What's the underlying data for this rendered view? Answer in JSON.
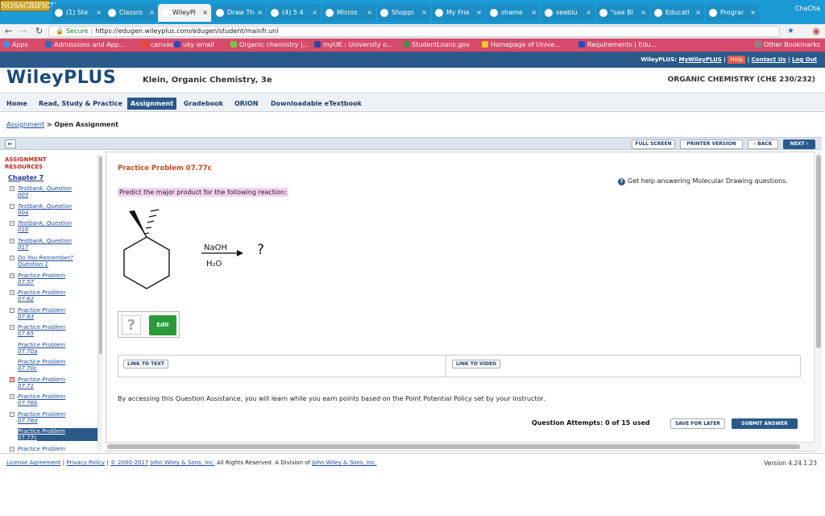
{
  "browser": {
    "profile_badge": "NOSACRIFICE",
    "user_name": "ChaCha",
    "tabs": [
      {
        "label": "(1) Ste"
      },
      {
        "label": "Classro"
      },
      {
        "label": "WileyPl"
      },
      {
        "label": "Draw Th"
      },
      {
        "label": "(4) 5 4"
      },
      {
        "label": "Micros"
      },
      {
        "label": "Shoppi"
      },
      {
        "label": "My Frie"
      },
      {
        "label": "shame"
      },
      {
        "label": "seeblu"
      },
      {
        "label": "\"see Bl"
      },
      {
        "label": "Educati"
      },
      {
        "label": "Prograr"
      }
    ],
    "secure_label": "Secure",
    "url": "https://edugen.wileyplus.com/edugen/student/mainfr.uni",
    "bookmarks": [
      {
        "label": "Apps",
        "color": "#4a90d9"
      },
      {
        "label": "Admissions and App...",
        "color": "#2a6ac4"
      },
      {
        "label": "canvas",
        "color": "#e84a2a"
      },
      {
        "label": "uky email",
        "color": "#2a4ab4"
      },
      {
        "label": "Organic chemistry |...",
        "color": "#7ac44a"
      },
      {
        "label": "myUK : University o...",
        "color": "#2a4a9a"
      },
      {
        "label": "StudentLoans.gov",
        "color": "#4a8a4a"
      },
      {
        "label": "Homepage of Unive...",
        "color": "#f4c42a"
      },
      {
        "label": "Requirements | Edu...",
        "color": "#2a4ab4"
      }
    ],
    "other_bookmarks": "Other Bookmarks"
  },
  "toplinks": {
    "wileyplus": "WileyPLUS:",
    "mywileyplus": "MyWileyPLUS",
    "help": "Help",
    "contact": "Contact Us",
    "logout": "Log Out",
    "sep": "|"
  },
  "header": {
    "logo": "WileyPLUS",
    "course": "Klein, Organic Chemistry, 3e",
    "course_code": "ORGANIC CHEMISTRY (CHE 230/232)"
  },
  "menu": [
    "Home",
    "Read, Study & Practice",
    "Assignment",
    "Gradebook",
    "ORION",
    "Downloadable eTextbook"
  ],
  "breadcrumb": {
    "link": "Assignment",
    "sep": ">",
    "current": "Open Assignment"
  },
  "toolbar": {
    "full_screen": "FULL SCREEN",
    "printer": "PRINTER VERSION",
    "back": "‹ BACK",
    "next": "NEXT ›"
  },
  "sidebar": {
    "title_line1": "ASSIGNMENT",
    "title_line2": "RESOURCES",
    "chapter": "Chapter 7",
    "items": [
      {
        "l1": "Testbank, Question",
        "l2": "003",
        "mark": "−"
      },
      {
        "l1": "Testbank, Question",
        "l2": "004",
        "mark": "−"
      },
      {
        "l1": "Testbank, Question",
        "l2": "010",
        "mark": "−"
      },
      {
        "l1": "Testbank, Question",
        "l2": "017",
        "mark": "−"
      },
      {
        "l1": "Do You Remember?",
        "l2": "Question 1",
        "mark": "−"
      },
      {
        "l1": "Practice Problem",
        "l2": "07.57",
        "mark": "−"
      },
      {
        "l1": "Practice Problem",
        "l2": "07.62",
        "mark": "−"
      },
      {
        "l1": "Practice Problem",
        "l2": "07.63",
        "mark": "−"
      },
      {
        "l1": "Practice Problem",
        "l2": "07.65",
        "mark": "−"
      },
      {
        "l1": "Practice Problem",
        "l2": "07.70a",
        "mark": ""
      },
      {
        "l1": "Practice Problem",
        "l2": "07.70c",
        "mark": ""
      },
      {
        "l1": "Practice Problem",
        "l2": "07.71",
        "mark": "x"
      },
      {
        "l1": "Practice Problem",
        "l2": "07.76b",
        "mark": "−"
      },
      {
        "l1": "Practice Problem",
        "l2": "07.76d",
        "mark": "−"
      },
      {
        "l1": "Practice Problem",
        "l2": "07.77c",
        "mark": ""
      },
      {
        "l1": "Practice Problem",
        "l2": "",
        "mark": "−"
      }
    ]
  },
  "problem": {
    "title": "Practice Problem 07.77c",
    "help_text": "Get help answering Molecular Drawing questions.",
    "prompt": "Predict the major product for the following reaction:",
    "reagent_top": "NaOH",
    "reagent_bottom": "H₂O",
    "product": "?",
    "edit_label": "Edit",
    "placeholder_glyph": "?",
    "link_text": "LINK TO TEXT",
    "link_video": "LINK TO VIDEO",
    "policy": "By accessing this Question Assistance, you will learn while you earn points based on the Point Potential Policy set by your instructor.",
    "attempts": "Question Attempts: 0 of 15 used",
    "save_later": "SAVE FOR LATER",
    "submit": "SUBMIT ANSWER"
  },
  "footer": {
    "license": "License Agreement",
    "privacy": "Privacy Policy",
    "copyright": "© 2000-2017",
    "company": "John Wiley & Sons, Inc.",
    "rights": "All Rights Reserved. A Division of",
    "company2": "John Wiley & Sons, Inc.",
    "sep": "|",
    "version": "Version 4.24.1.23"
  }
}
